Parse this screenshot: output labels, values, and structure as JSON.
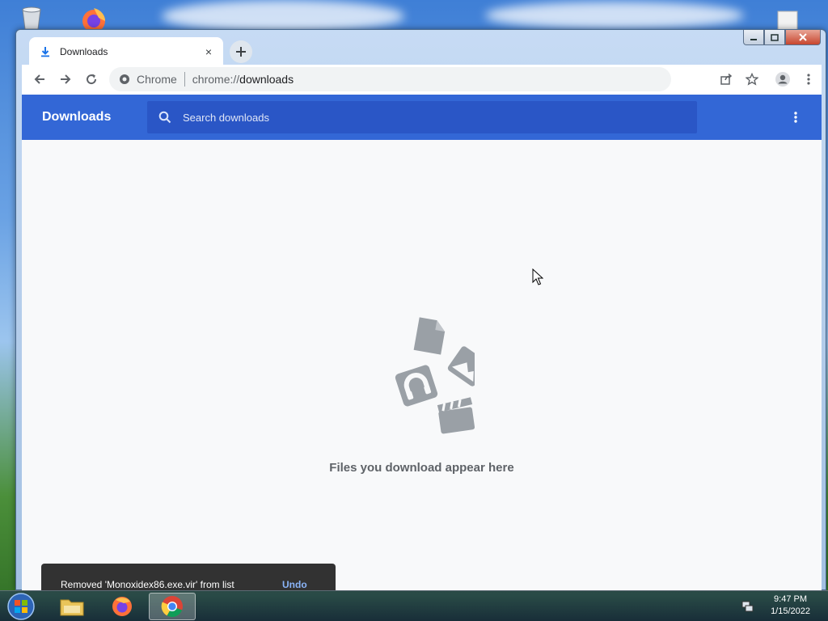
{
  "tab": {
    "title": "Downloads",
    "close_glyph": "×"
  },
  "toolbar": {
    "site_label": "Chrome",
    "url_scheme": "chrome://",
    "url_path": "downloads"
  },
  "downloads_page": {
    "header_title": "Downloads",
    "search_placeholder": "Search downloads",
    "empty_message": "Files you download appear here"
  },
  "toast": {
    "message": "Removed 'Monoxidex86.exe.vir' from list",
    "action": "Undo"
  },
  "taskbar": {
    "time": "9:47 PM",
    "date": "1/15/2022"
  },
  "colors": {
    "header_blue": "#3367d6",
    "search_bg": "#2a56c6",
    "toast_bg": "#323232",
    "undo_link": "#8ab4f8"
  }
}
